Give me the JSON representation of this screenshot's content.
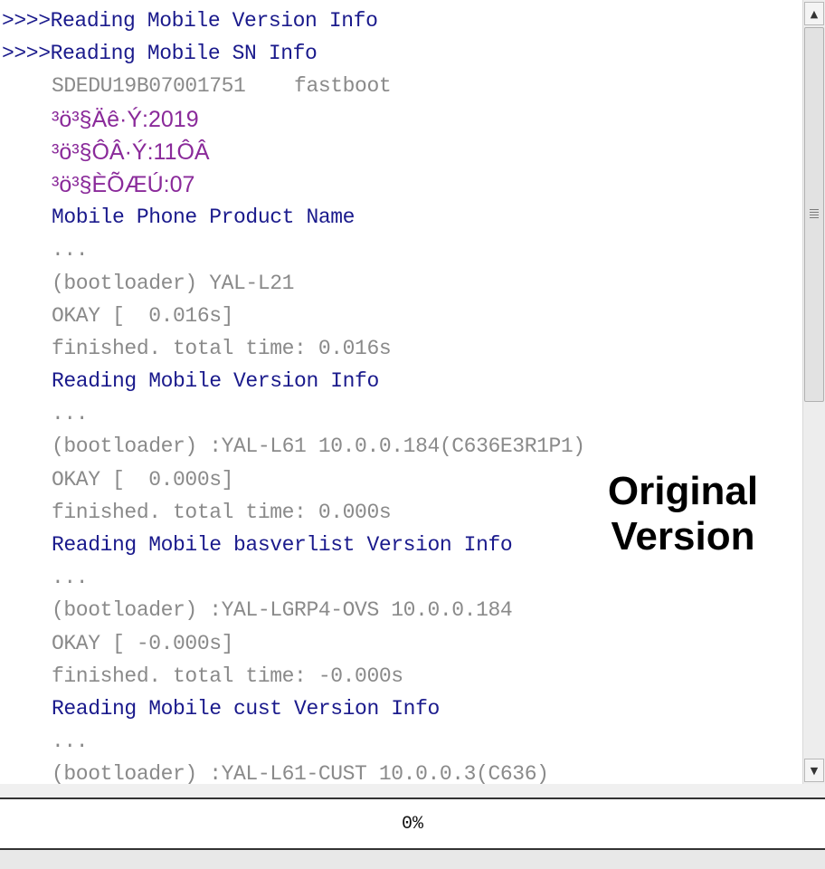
{
  "log": {
    "lines": [
      {
        "text": ">>>>Reading Mobile Version Info",
        "style": "blue",
        "indent": 0
      },
      {
        "text": ">>>>Reading Mobile SN Info",
        "style": "blue",
        "indent": 0
      },
      {
        "text": "SDEDU19B07001751    fastboot",
        "style": "gray",
        "indent": 1
      },
      {
        "text": "³ö³§Äê·Ý:2019",
        "style": "purple",
        "indent": 1
      },
      {
        "text": "³ö³§ÔÂ·Ý:11ÔÂ",
        "style": "purple",
        "indent": 1
      },
      {
        "text": "³ö³§ÈÕÆÚ:07",
        "style": "purple",
        "indent": 1
      },
      {
        "text": "Mobile Phone Product Name",
        "style": "blue",
        "indent": 1
      },
      {
        "text": "...",
        "style": "gray",
        "indent": 1
      },
      {
        "text": "(bootloader) YAL-L21",
        "style": "gray",
        "indent": 1
      },
      {
        "text": "OKAY [  0.016s]",
        "style": "gray",
        "indent": 1
      },
      {
        "text": "finished. total time: 0.016s",
        "style": "gray",
        "indent": 1
      },
      {
        "text": "Reading Mobile Version Info",
        "style": "blue",
        "indent": 1
      },
      {
        "text": "...",
        "style": "gray",
        "indent": 1
      },
      {
        "text": "(bootloader) :YAL-L61 10.0.0.184(C636E3R1P1)",
        "style": "gray",
        "indent": 1
      },
      {
        "text": "OKAY [  0.000s]",
        "style": "gray",
        "indent": 1
      },
      {
        "text": "finished. total time: 0.000s",
        "style": "gray",
        "indent": 1
      },
      {
        "text": "Reading Mobile basverlist Version Info",
        "style": "blue",
        "indent": 1
      },
      {
        "text": "...",
        "style": "gray",
        "indent": 1
      },
      {
        "text": "(bootloader) :YAL-LGRP4-OVS 10.0.0.184",
        "style": "gray",
        "indent": 1
      },
      {
        "text": "OKAY [ -0.000s]",
        "style": "gray",
        "indent": 1
      },
      {
        "text": "finished. total time: -0.000s",
        "style": "gray",
        "indent": 1
      },
      {
        "text": "Reading Mobile cust Version Info",
        "style": "blue",
        "indent": 1
      },
      {
        "text": "...",
        "style": "gray",
        "indent": 1
      },
      {
        "text": "(bootloader) :YAL-L61-CUST 10.0.0.3(C636)",
        "style": "gray",
        "indent": 1
      }
    ]
  },
  "watermark": {
    "line1": "Original",
    "line2": "Version"
  },
  "scrollbar": {
    "up_icon": "▲",
    "down_icon": "▼"
  },
  "progress": {
    "label": "0%",
    "value": 0
  },
  "colors": {
    "blue": "#1a1a8c",
    "gray": "#8a8a8a",
    "purple": "#8a2a9a",
    "progress_fill": "#3a7bd5"
  }
}
